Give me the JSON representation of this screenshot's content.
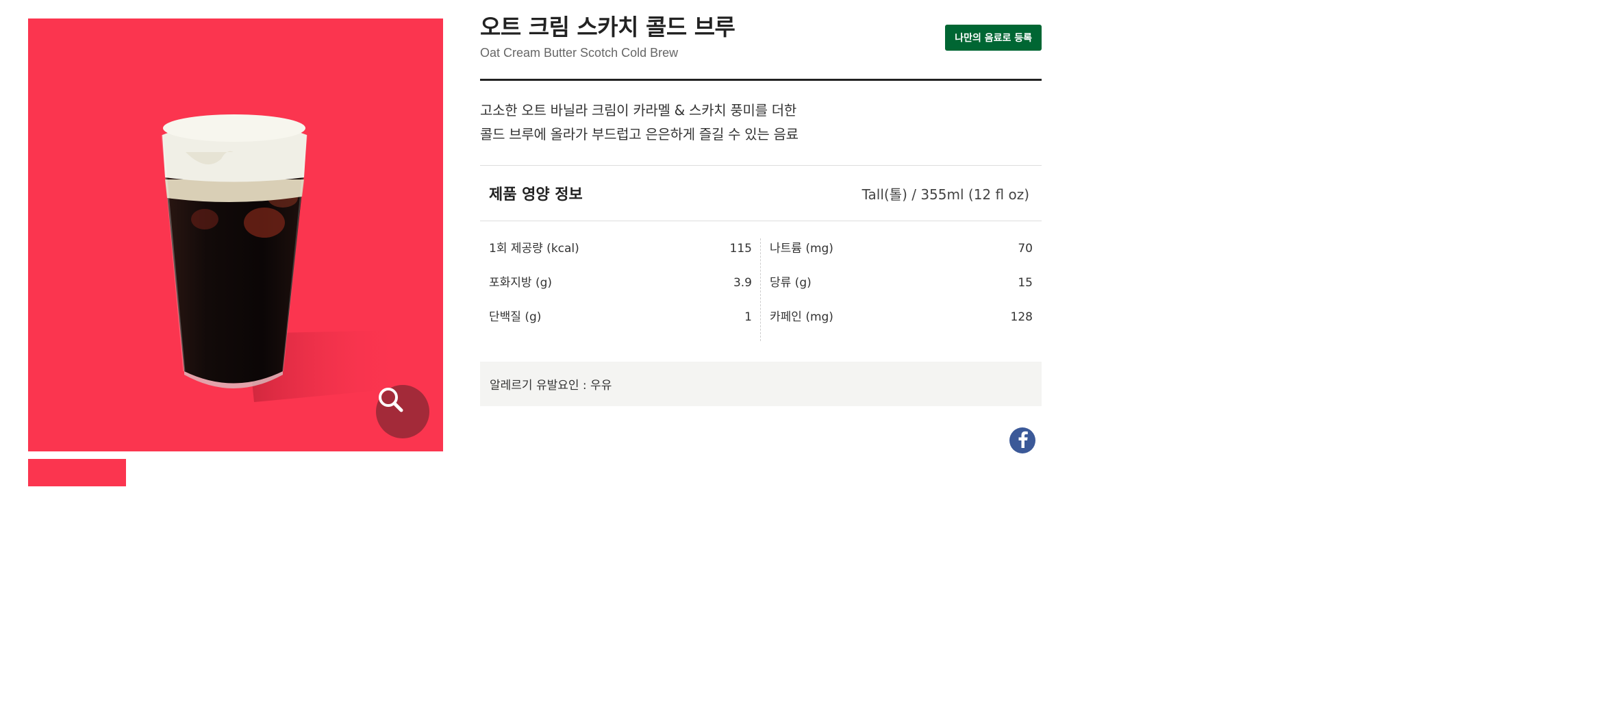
{
  "product": {
    "title_ko": "오트 크림 스카치 콜드 브루",
    "title_en": "Oat Cream Butter Scotch Cold Brew",
    "register_label": "나만의 음료로 등록",
    "description_line1": "고소한 오트 바닐라 크림이 카라멜 & 스카치 풍미를 더한",
    "description_line2": "콜드 브루에 올라가 부드럽고 은은하게 즐길 수 있는 음료",
    "image_bg_color": "#fb354f",
    "brand_color": "#006633"
  },
  "nutrition": {
    "title": "제품 영양 정보",
    "size": "Tall(톨) / 355ml (12 fl oz)",
    "left": [
      {
        "label": "1회 제공량 (kcal)",
        "value": "115"
      },
      {
        "label": "포화지방 (g)",
        "value": "3.9"
      },
      {
        "label": "단백질 (g)",
        "value": "1"
      }
    ],
    "right": [
      {
        "label": "나트륨 (mg)",
        "value": "70"
      },
      {
        "label": "당류 (g)",
        "value": "15"
      },
      {
        "label": "카페인 (mg)",
        "value": "128"
      }
    ]
  },
  "allergy": {
    "text": "알레르기 유발요인 : 우유"
  },
  "icons": {
    "zoom": "search-icon",
    "share": "facebook-icon"
  }
}
